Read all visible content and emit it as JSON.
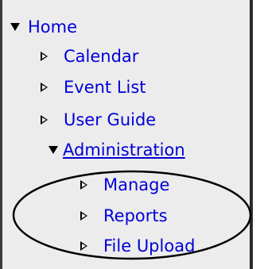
{
  "nav": {
    "home": {
      "label": "Home",
      "icon": "expanded-triangle-icon"
    },
    "items": [
      {
        "label": "Calendar",
        "icon": "collapsed-triangle-icon"
      },
      {
        "label": "Event List",
        "icon": "collapsed-triangle-icon"
      },
      {
        "label": "User Guide",
        "icon": "collapsed-triangle-icon"
      }
    ],
    "admin": {
      "label": "Administration",
      "icon": "expanded-triangle-icon"
    },
    "admin_items": [
      {
        "label": "Manage",
        "icon": "collapsed-triangle-icon"
      },
      {
        "label": "Reports",
        "icon": "collapsed-triangle-icon"
      },
      {
        "label": "File Upload",
        "icon": "collapsed-triangle-icon"
      }
    ]
  },
  "colors": {
    "link": "#0000d8",
    "background": "#ececec",
    "annotation": "#000000"
  }
}
